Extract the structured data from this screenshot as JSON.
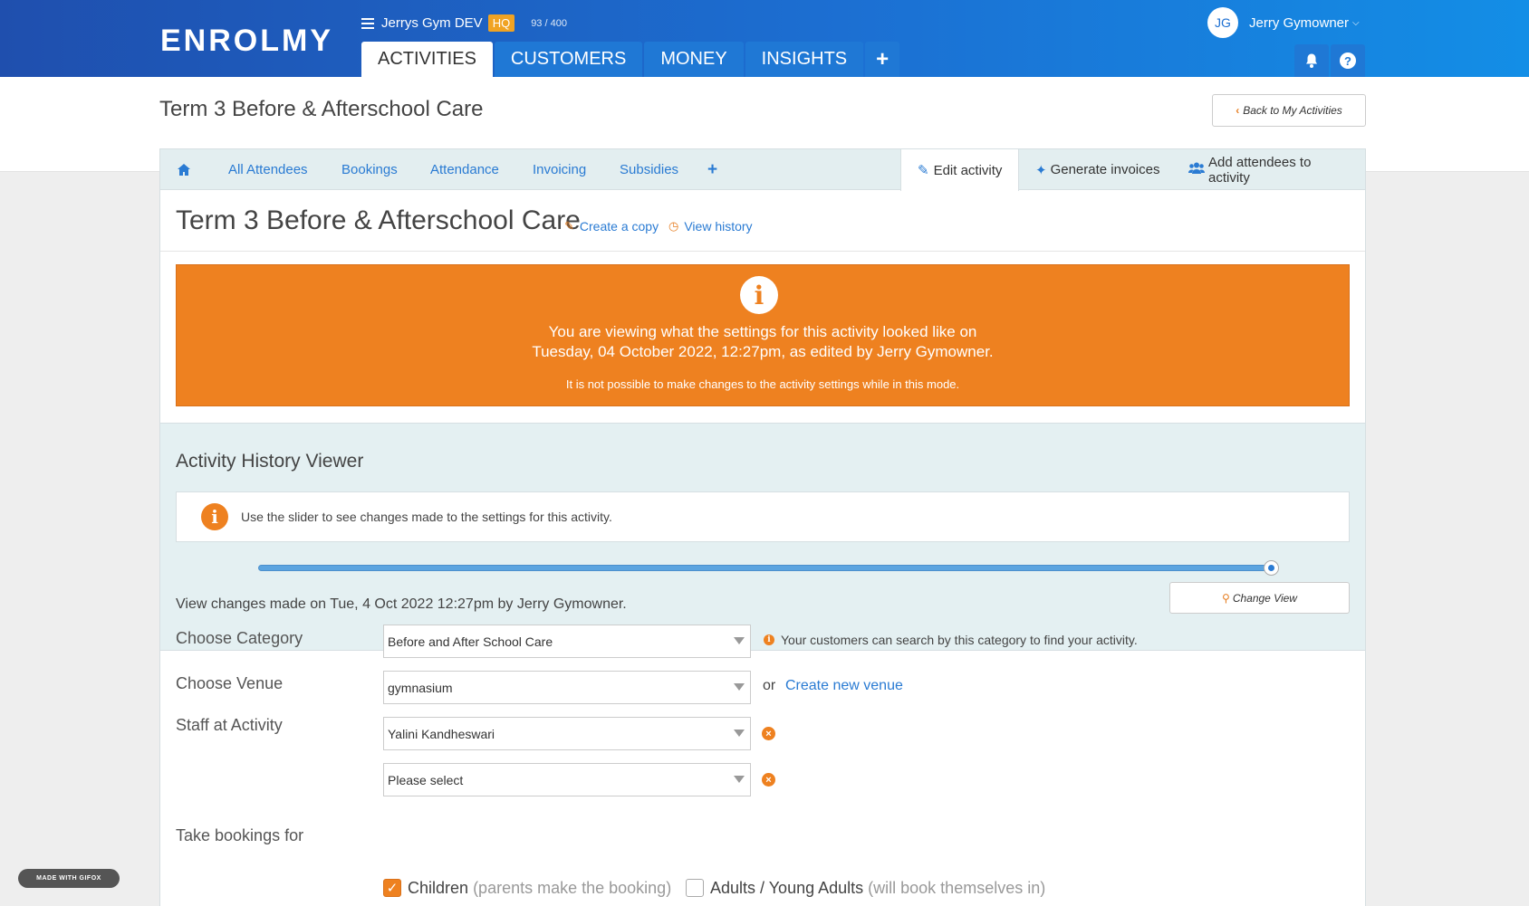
{
  "brand": {
    "logo": "ENROLMY"
  },
  "org": {
    "name": "Jerrys Gym DEV",
    "badge": "HQ",
    "count": "93 / 400"
  },
  "nav": {
    "tabs": [
      "ACTIVITIES",
      "CUSTOMERS",
      "MONEY",
      "INSIGHTS"
    ],
    "active": "ACTIVITIES",
    "plus": "+"
  },
  "user": {
    "initials": "JG",
    "name": "Jerry Gymowner"
  },
  "topicons": {
    "help": "?"
  },
  "header": {
    "title": "Term 3 Before & Afterschool Care",
    "back_label": "Back to My Activities"
  },
  "subnav": {
    "items": [
      "All Attendees",
      "Bookings",
      "Attendance",
      "Invoicing",
      "Subsidies"
    ],
    "plus": "+",
    "right": [
      "Edit activity",
      "Generate invoices",
      "Add attendees to activity"
    ],
    "active": "Edit activity"
  },
  "activity": {
    "title": "Term 3 Before & Afterschool Care",
    "copy_link": "Create a copy",
    "history_link": "View history"
  },
  "alert": {
    "icon": "i",
    "line1": "You are viewing what the settings for this activity looked like on",
    "line2": "Tuesday, 04 October 2022, 12:27pm, as edited by Jerry Gymowner.",
    "line3": "It is not possible to make changes to the activity settings while in this mode."
  },
  "history": {
    "title": "Activity History Viewer",
    "info_icon": "i",
    "info": "Use the slider to see changes made to the settings for this activity.",
    "slider_position": 1.0,
    "view_text": "View changes made on Tue, 4 Oct 2022 12:27pm by Jerry Gymowner.",
    "change_view_label": "Change View"
  },
  "form": {
    "category": {
      "label": "Choose Category",
      "value": "Before and After School Care",
      "hint": "Your customers can search by this category to find your activity."
    },
    "venue": {
      "label": "Choose Venue",
      "value": "gymnasium",
      "or": "or",
      "create_link": "Create new venue"
    },
    "staff": {
      "label": "Staff at Activity",
      "values": [
        "Yalini Kandheswari",
        "Please select"
      ]
    },
    "bookings": {
      "label": "Take bookings for",
      "options": [
        {
          "label": "Children",
          "note": "(parents make the booking)",
          "checked": true
        },
        {
          "label": "Adults / Young Adults",
          "note": "(will book themselves in)",
          "checked": false
        }
      ]
    }
  },
  "watermark": "MADE WITH GIFOX",
  "colors": {
    "primary_blue": "#1c6fd2",
    "accent_orange": "#ee8120",
    "link_blue": "#2a7bd3",
    "history_bg": "#e4f0f2"
  }
}
